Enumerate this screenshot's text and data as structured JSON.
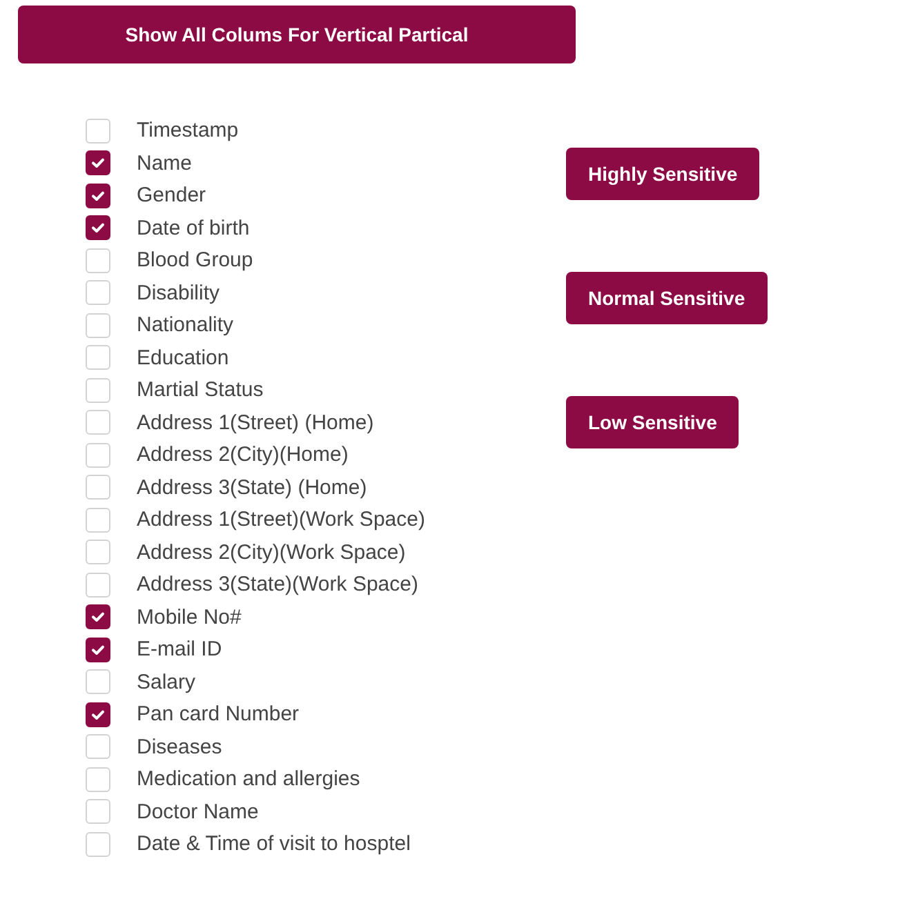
{
  "show_all_button": "Show All Colums For Vertical Partical",
  "columns": [
    {
      "label": "Timestamp",
      "checked": false
    },
    {
      "label": "Name",
      "checked": true
    },
    {
      "label": "Gender",
      "checked": true
    },
    {
      "label": "Date of birth",
      "checked": true
    },
    {
      "label": "Blood Group",
      "checked": false
    },
    {
      "label": "Disability",
      "checked": false
    },
    {
      "label": "Nationality",
      "checked": false
    },
    {
      "label": "Education",
      "checked": false
    },
    {
      "label": "Martial Status",
      "checked": false
    },
    {
      "label": "Address 1(Street) (Home)",
      "checked": false
    },
    {
      "label": "Address 2(City)(Home)",
      "checked": false
    },
    {
      "label": "Address 3(State) (Home)",
      "checked": false
    },
    {
      "label": "Address 1(Street)(Work Space)",
      "checked": false
    },
    {
      "label": "Address 2(City)(Work Space)",
      "checked": false
    },
    {
      "label": "Address 3(State)(Work Space)",
      "checked": false
    },
    {
      "label": "Mobile No#",
      "checked": true
    },
    {
      "label": "E-mail ID",
      "checked": true
    },
    {
      "label": "Salary",
      "checked": false
    },
    {
      "label": "Pan card Number",
      "checked": true
    },
    {
      "label": "Diseases",
      "checked": false
    },
    {
      "label": "Medication and allergies",
      "checked": false
    },
    {
      "label": "Doctor Name",
      "checked": false
    },
    {
      "label": "Date & Time of visit to hosptel",
      "checked": false
    }
  ],
  "sensitivity_buttons": [
    "Highly Sensitive",
    "Normal Sensitive",
    "Low Sensitive"
  ]
}
